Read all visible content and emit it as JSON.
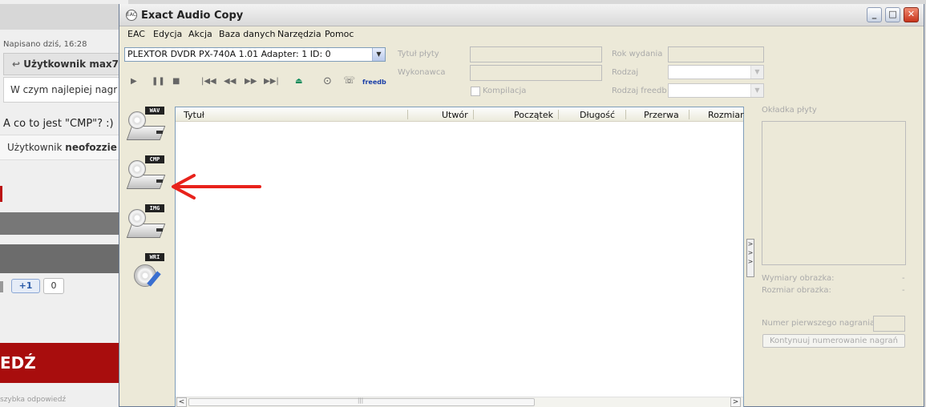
{
  "background_page": {
    "meta": "Napisano dziś, 16:28",
    "user_heading": "Użytkownik max7",
    "quote_text": "W czym najlepiej nagr",
    "question": "A co to jest \"CMP\"? :)",
    "user_line_prefix": "Użytkownik ",
    "user_line_name": "neofozzie",
    "plusone_label": "+1",
    "plusone_count": "0",
    "red_banner": "EDŹ",
    "bottom_text": "szybka odpowiedź"
  },
  "window": {
    "title": "Exact Audio Copy",
    "app_icon": "EAC",
    "controls": {
      "minimize": "_",
      "maximize": "□",
      "close": "✕"
    }
  },
  "menu": [
    "EAC",
    "Edycja",
    "Akcja",
    "Baza danych",
    "Narzędzia",
    "Pomoc"
  ],
  "drive": {
    "selected": "PLEXTOR DVDR   PX-740A 1.01   Adapter: 1  ID: 0",
    "arrow": "▼"
  },
  "transport": {
    "play": "▶",
    "pause": "❚❚",
    "stop": "■",
    "first": "|◀◀",
    "rewind": "◀◀",
    "forward": "▶▶",
    "last": "▶▶|",
    "eject": "⏏",
    "cd": "⊙",
    "freedb": "freedb"
  },
  "fields": {
    "album_title_label": "Tytuł płyty",
    "artist_label": "Wykonawca",
    "compilation_label": "Kompilacja",
    "year_label": "Rok wydania",
    "genre_label": "Rodzaj",
    "freedb_genre_label": "Rodzaj freedb"
  },
  "side_buttons": [
    {
      "tag": "WAV"
    },
    {
      "tag": "CMP"
    },
    {
      "tag": "IMG"
    },
    {
      "tag": "WRI"
    }
  ],
  "tracklist": {
    "columns": [
      "Tytuł",
      "Utwór",
      "Początek",
      "Długość",
      "Przerwa",
      "Rozmiar"
    ],
    "scroll_left": "<",
    "scroll_right": ">",
    "thumb_grip": "|||"
  },
  "expander": "> > >",
  "cover_panel": {
    "label": "Okładka płyty",
    "dims_label": "Wymiary obrazka:",
    "dims_value": "-",
    "size_label": "Rozmiar obrazka:",
    "size_value": "-",
    "first_track_label": "Numer pierwszego nagrania:",
    "continue_button": "Kontynuuj numerowanie nagrań"
  },
  "colors": {
    "annotation_arrow": "#e8221b",
    "window_bg": "#ece9d8",
    "banner_red": "#a80d0d"
  }
}
